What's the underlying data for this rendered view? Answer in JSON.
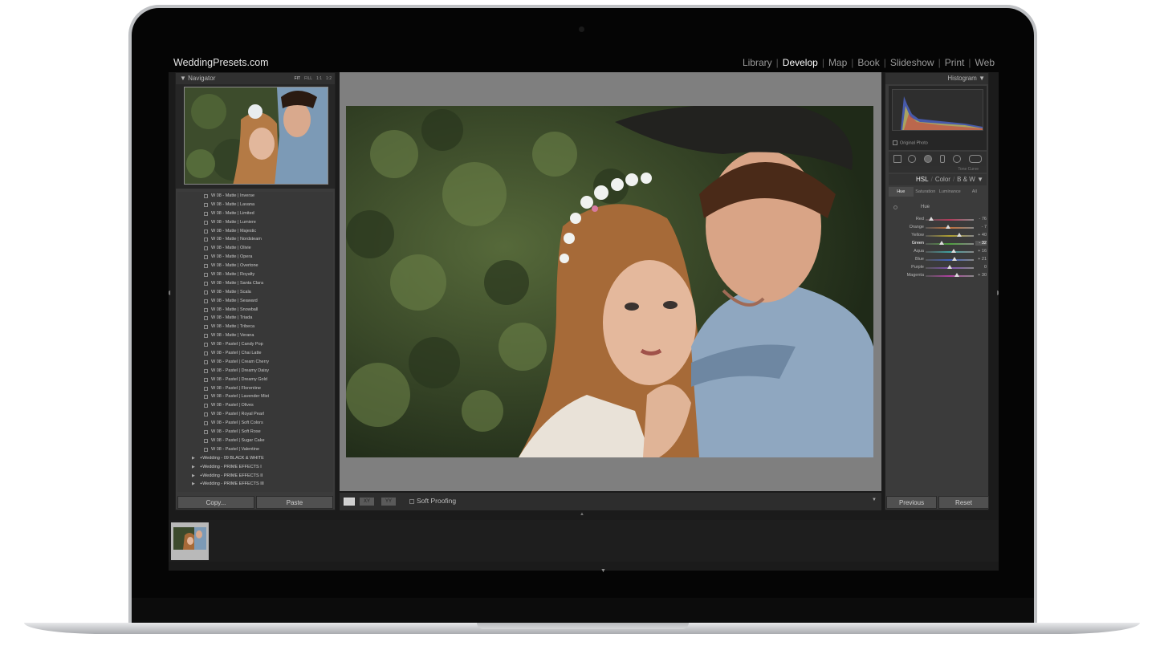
{
  "app": {
    "brand": "WeddingPresets.com",
    "modules": [
      {
        "label": "Library",
        "active": false
      },
      {
        "label": "Develop",
        "active": true
      },
      {
        "label": "Map",
        "active": false
      },
      {
        "label": "Book",
        "active": false
      },
      {
        "label": "Slideshow",
        "active": false
      },
      {
        "label": "Print",
        "active": false
      },
      {
        "label": "Web",
        "active": false
      }
    ]
  },
  "navigator": {
    "title": "Navigator",
    "zoom_options": [
      "FIT",
      "FILL",
      "1:1",
      "1:2"
    ]
  },
  "presets": {
    "items": [
      "W 08 - Matte | Inverse",
      "W 08 - Matte | Lavana",
      "W 08 - Matte | Limited",
      "W 08 - Matte | Lumiere",
      "W 08 - Matte | Majestic",
      "W 08 - Matte | Nordsteam",
      "W 08 - Matte | Olivie",
      "W 08 - Matte | Opera",
      "W 08 - Matte | Overtone",
      "W 08 - Matte | Royalty",
      "W 08 - Matte | Santa Clara",
      "W 08 - Matte | Scala",
      "W 08 - Matte | Seaward",
      "W 08 - Matte | Snowball",
      "W 08 - Matte | Triada",
      "W 08 - Matte | Tribeca",
      "W 08 - Matte | Verana",
      "W 08 - Pastel | Candy Pop",
      "W 08 - Pastel | Chai Latte",
      "W 08 - Pastel | Cream Cherry",
      "W 08 - Pastel | Dreamy Daisy",
      "W 08 - Pastel | Dreamy Gold",
      "W 08 - Pastel | Florentine",
      "W 08 - Pastel | Lavender Mist",
      "W 08 - Pastel | Olives",
      "W 08 - Pastel | Royal Pearl",
      "W 08 - Pastel | Soft Colors",
      "W 08 - Pastel | Soft Rose",
      "W 08 - Pastel | Sugar Cake",
      "W 08 - Pastel | Valentine"
    ],
    "folders": [
      "+Wedding - 09 BLACK & WHITE",
      "+Wedding - PRIME EFFECTS I",
      "+Wedding - PRIME EFFECTS II",
      "+Wedding - PRIME EFFECTS III"
    ],
    "copy_label": "Copy...",
    "paste_label": "Paste"
  },
  "toolbar": {
    "soft_proofing_label": "Soft Proofing",
    "compare_label": "XY",
    "survey_label": "YY"
  },
  "histogram": {
    "title": "Histogram",
    "original_photo_label": "Original Photo",
    "tone_curve_label": "Tone Curve"
  },
  "hsl": {
    "header": {
      "hsl": "HSL",
      "color": "Color",
      "bw": "B & W"
    },
    "tabs": [
      {
        "label": "Hue",
        "active": true
      },
      {
        "label": "Saturation",
        "active": false
      },
      {
        "label": "Luminance",
        "active": false
      },
      {
        "label": "All",
        "active": false
      }
    ],
    "section_title": "Hue",
    "sliders": [
      {
        "label": "Red",
        "value": "- 76",
        "level": 0.12,
        "track": "#b23a5a",
        "highlight": false
      },
      {
        "label": "Orange",
        "value": "- 7",
        "level": 0.46,
        "track": "#c0703a",
        "highlight": false
      },
      {
        "label": "Yellow",
        "value": "+ 40",
        "level": 0.7,
        "track": "#b0a030",
        "highlight": false
      },
      {
        "label": "Green",
        "value": "- 32",
        "level": 0.34,
        "track": "#50a040",
        "highlight": true
      },
      {
        "label": "Aqua",
        "value": "+ 16",
        "level": 0.58,
        "track": "#40a0a0",
        "highlight": false
      },
      {
        "label": "Blue",
        "value": "+ 21",
        "level": 0.6,
        "track": "#4060c0",
        "highlight": false
      },
      {
        "label": "Purple",
        "value": "0",
        "level": 0.5,
        "track": "#8050b0",
        "highlight": false
      },
      {
        "label": "Magenta",
        "value": "+ 30",
        "level": 0.65,
        "track": "#b040a0",
        "highlight": false
      }
    ]
  },
  "right_buttons": {
    "previous": "Previous",
    "reset": "Reset"
  },
  "colors": {
    "accent": "#ffffff",
    "panel": "#3b3b3b"
  }
}
